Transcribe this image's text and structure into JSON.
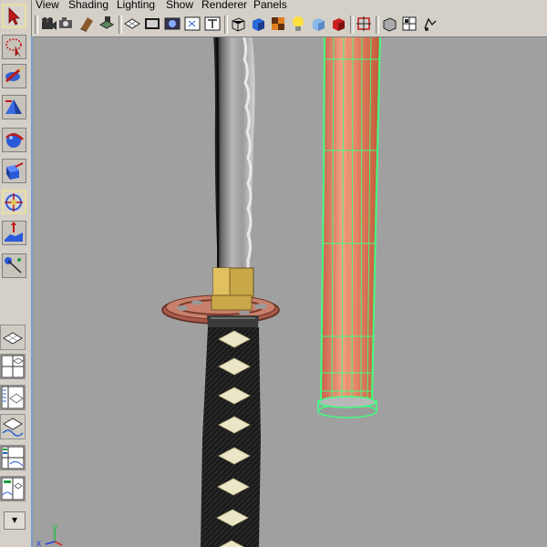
{
  "menu": {
    "items": [
      {
        "label": "View"
      },
      {
        "label": "Shading"
      },
      {
        "label": "Lighting"
      },
      {
        "label": "Show"
      },
      {
        "label": "Renderer"
      },
      {
        "label": "Panels"
      }
    ]
  },
  "axis": {
    "y": "y",
    "x": "x"
  },
  "colors": {
    "viewport_bg": "#a0a0a0",
    "panel_bg": "#d4d0c8",
    "wireframe": "#40ff80",
    "wood": "#e88a6a",
    "tsuba": "#c8806c",
    "habaki": "#c8a848",
    "wrap": "#1a1a1a",
    "diamond": "#ece6c8"
  },
  "toolbox": {
    "tools": [
      "select-tool-icon",
      "lasso-tool-icon",
      "paint-select-icon",
      "move-tool-icon",
      "rotate-tool-icon",
      "scale-tool-icon",
      "universal-manip-icon",
      "soft-mod-icon",
      "show-manip-icon"
    ],
    "layouts": [
      "single-pane-icon",
      "four-pane-icon",
      "two-pane-icon",
      "persp-outliner-icon",
      "graph-editor-icon",
      "hypershade-icon",
      "render-view-icon"
    ]
  }
}
